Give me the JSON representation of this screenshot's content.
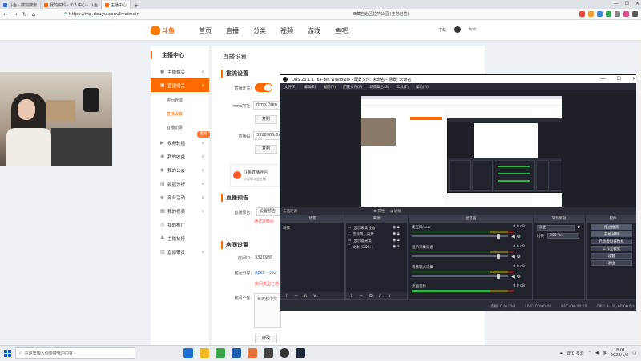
{
  "browser": {
    "tabs": [
      {
        "label": "斗鱼 - 搜狗搜索",
        "color": "#3b6fd8"
      },
      {
        "label": "我的资料 - 个人中心 - 斗鱼",
        "color": "#ff6a00"
      },
      {
        "label": "主播中心",
        "color": "#ff6a00",
        "active": true
      }
    ],
    "url": "https://mp.douyu.com/live/main",
    "extra_tab_title": "西藏自治区拉萨公园 (王地自拍)"
  },
  "header": {
    "logo_text": "斗鱼",
    "nav": [
      "首页",
      "直播",
      "分类",
      "视频",
      "游戏",
      "鱼吧"
    ],
    "download": "下载",
    "username": "fyst"
  },
  "sidebar": {
    "title": "主播中心",
    "items": [
      {
        "label": "主播相关",
        "icon": "mic-icon"
      },
      {
        "label": "直播相关",
        "icon": "live-icon",
        "active": true
      },
      {
        "label": "房间管理",
        "sub": true
      },
      {
        "label": "直播设置",
        "sub": true,
        "current": true
      },
      {
        "label": "直播记录",
        "sub": true
      },
      {
        "label": "视频轮播",
        "icon": "video-icon"
      },
      {
        "label": "我的收益",
        "icon": "coin-icon"
      },
      {
        "label": "我的公会",
        "icon": "guild-icon"
      },
      {
        "label": "数据分析",
        "icon": "chart-icon"
      },
      {
        "label": "商业活动",
        "icon": "biz-icon"
      },
      {
        "label": "我的视频",
        "icon": "film-icon"
      },
      {
        "label": "我的推广",
        "icon": "promo-icon"
      },
      {
        "label": "主播扶持",
        "icon": "support-icon"
      },
      {
        "label": "直播带货",
        "icon": "cart-icon"
      }
    ],
    "new_badge": "更新"
  },
  "content": {
    "page_title": "直播设置",
    "stream_section": "推流设置",
    "live_switch_label": "直播开关:",
    "rtmp_label": "rtmp地址:",
    "rtmp_value": "rtmp://sen",
    "copy1": "复制",
    "key_label": "直播码:",
    "key_value": "3328988r3x",
    "copy2": "复制",
    "promo_title": "斗鱼直播伴侣",
    "promo_sub": "你要做斗鱼主播",
    "forecast_section": "直播预告",
    "forecast_label": "直播预告:",
    "forecast_value": "设置预告",
    "forecast_warn": "通过审核后",
    "room_section": "房间设置",
    "room_id_label": "房间ID:",
    "room_id": "3328988",
    "room_cat_label": "房间分类:",
    "room_cat": "Apex - 332",
    "room_cat_warn": "房间类型已通",
    "room_notice_label": "房间公告:",
    "room_notice": "每天都中奖",
    "modify": "修改"
  },
  "obs": {
    "title": "OBS 26.1.1 (64-bit, windows) - 配置文件: 未命名 - 场景: 未命名",
    "menu": [
      "文件(F)",
      "编辑(E)",
      "视图(V)",
      "配置文件(P)",
      "场景集合(S)",
      "工具(T)",
      "帮助(H)"
    ],
    "scene_header": "未选定源",
    "prop_btn": "属性",
    "filter_btn": "滤镜",
    "docks": {
      "scenes": "场景",
      "sources": "来源",
      "mixer": "混音器",
      "transitions": "转场特效",
      "controls": "控件"
    },
    "scene_items": [
      "场景"
    ],
    "source_items": [
      "显示采集设备",
      "音频输入采集",
      "显示器采集",
      "文本 (GDI+)"
    ],
    "mixer_tracks": [
      {
        "name": "麦克风/Aux",
        "db": "0.0 dB"
      },
      {
        "name": "显示采集设备",
        "db": "0.0 dB"
      },
      {
        "name": "音频输入采集",
        "db": "0.0 dB"
      },
      {
        "name": "桌面音频",
        "db": "0.0 dB"
      }
    ],
    "transition": "淡出",
    "duration_label": "时长",
    "duration": "300 ms",
    "controls": [
      "停止推流",
      "开始录制",
      "启动虚拟摄像机",
      "工作室模式",
      "设置",
      "退出"
    ],
    "status": {
      "dropped": "丢帧: 0 (0.0%)",
      "live": "LIVE: 00:00:00",
      "rec": "REC: 00:00:00",
      "cpu": "CPU: 9.4%, 60.00 fps"
    }
  },
  "taskbar": {
    "search_placeholder": "在这里输入你要搜索的内容",
    "weather": "8°C 多云",
    "time": "18:01",
    "date": "2022/1/8",
    "lang": "英"
  }
}
